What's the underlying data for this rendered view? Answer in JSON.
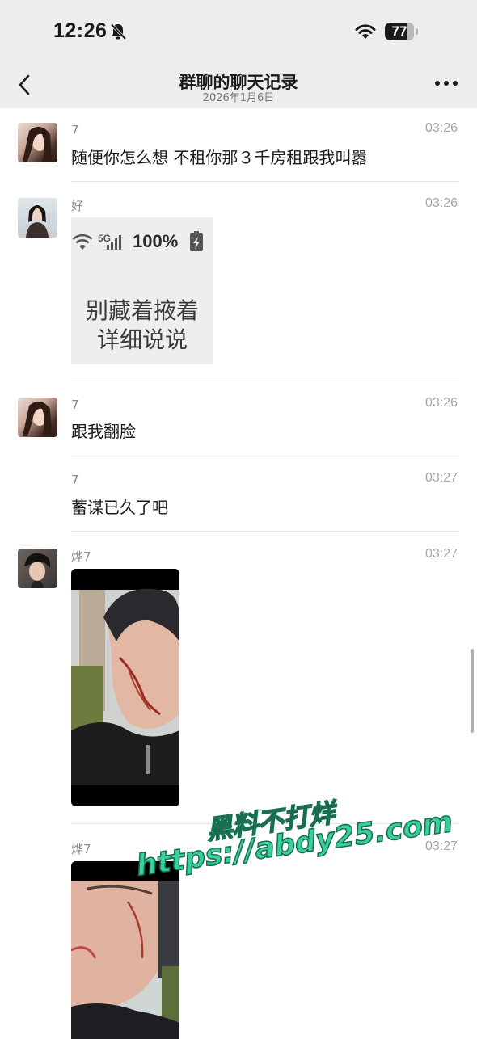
{
  "status": {
    "time": "12:26",
    "battery": "77",
    "battery_fraction": 0.77
  },
  "nav": {
    "title": "群聊的聊天记录",
    "subtitle": "2026年1月6日"
  },
  "messages": [
    {
      "sender": "7",
      "time": "03:26",
      "text": "随便你怎么想 不租你那３千房租跟我叫嚣"
    },
    {
      "sender": "好",
      "time": "03:26",
      "sticker": {
        "status_text": "5G",
        "battery_text": "100%",
        "line1": "别藏着掖着",
        "line2": "详细说说"
      }
    },
    {
      "sender": "7",
      "time": "03:26",
      "text": "跟我翻脸"
    },
    {
      "sender": "7",
      "time": "03:27",
      "text": "蓄谋已久了吧"
    },
    {
      "sender": "烨7",
      "time": "03:27"
    },
    {
      "sender": "烨7",
      "time": "03:27"
    }
  ],
  "watermark": {
    "line1": "黑料不打烊",
    "line2": "https://abdy25.com"
  },
  "icons": {
    "back": "chevron-left-icon",
    "more": "more-dots-icon",
    "bell": "bell-slash-icon",
    "wifi": "wifi-icon",
    "battery": "battery-icon",
    "sticker_wifi": "wifi-icon",
    "sticker_signal": "signal-icon",
    "sticker_battery": "battery-charging-icon"
  },
  "colors": {
    "background": "#ffffff",
    "header": "#ededed",
    "watermark": "#3ad09a"
  }
}
